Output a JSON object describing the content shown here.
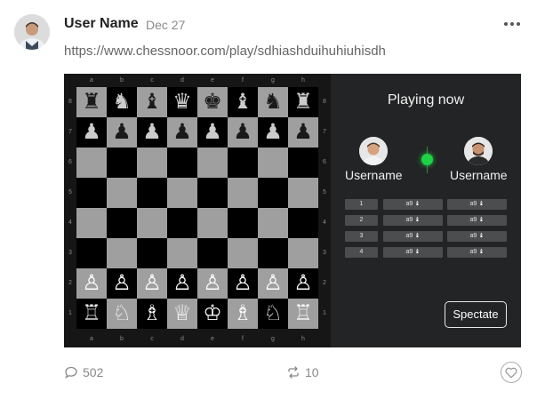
{
  "post": {
    "username": "User Name",
    "date": "Dec 27",
    "url": "https://www.chessnoor.com/play/sdhiashduihuhiuhisdh"
  },
  "board": {
    "files": [
      "a",
      "b",
      "c",
      "d",
      "e",
      "f",
      "g",
      "h"
    ],
    "ranks": [
      "8",
      "7",
      "6",
      "5",
      "4",
      "3",
      "2",
      "1"
    ],
    "position": [
      [
        "♜",
        "♞",
        "♝",
        "♛",
        "♚",
        "♝",
        "♞",
        "♜"
      ],
      [
        "♟",
        "♟",
        "♟",
        "♟",
        "♟",
        "♟",
        "♟",
        "♟"
      ],
      [
        "",
        "",
        "",
        "",
        "",
        "",
        "",
        ""
      ],
      [
        "",
        "",
        "",
        "",
        "",
        "",
        "",
        ""
      ],
      [
        "",
        "",
        "",
        "",
        "",
        "",
        "",
        ""
      ],
      [
        "",
        "",
        "",
        "",
        "",
        "",
        "",
        ""
      ],
      [
        "♙",
        "♙",
        "♙",
        "♙",
        "♙",
        "♙",
        "♙",
        "♙"
      ],
      [
        "♖",
        "♘",
        "♗",
        "♕",
        "♔",
        "♗",
        "♘",
        "♖"
      ]
    ]
  },
  "panel": {
    "title": "Playing now",
    "player_left": "Username",
    "player_right": "Username",
    "live_color": "#1fd145",
    "moves": [
      {
        "num": "1",
        "white": "a9 ♝",
        "black": "a9 ♝"
      },
      {
        "num": "2",
        "white": "a9 ♝",
        "black": "a9 ♝"
      },
      {
        "num": "3",
        "white": "a9 ♝",
        "black": "a9 ♝"
      },
      {
        "num": "4",
        "white": "a9 ♝",
        "black": "a9 ♝"
      }
    ],
    "spectate_label": "Spectate"
  },
  "footer": {
    "comments": "502",
    "reposts": "10",
    "comment_icon": "comment-icon",
    "repost_icon": "repost-icon",
    "like_icon": "heart-icon"
  }
}
